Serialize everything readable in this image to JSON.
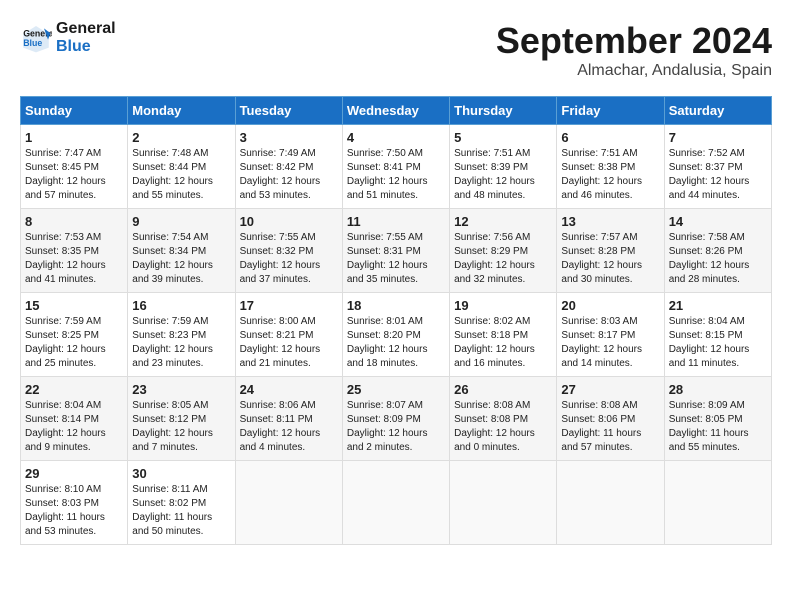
{
  "logo": {
    "line1": "General",
    "line2": "Blue"
  },
  "title": "September 2024",
  "location": "Almachar, Andalusia, Spain",
  "days_of_week": [
    "Sunday",
    "Monday",
    "Tuesday",
    "Wednesday",
    "Thursday",
    "Friday",
    "Saturday"
  ],
  "weeks": [
    [
      {
        "day": "1",
        "sunrise": "7:47 AM",
        "sunset": "8:45 PM",
        "daylight": "12 hours and 57 minutes."
      },
      {
        "day": "2",
        "sunrise": "7:48 AM",
        "sunset": "8:44 PM",
        "daylight": "12 hours and 55 minutes."
      },
      {
        "day": "3",
        "sunrise": "7:49 AM",
        "sunset": "8:42 PM",
        "daylight": "12 hours and 53 minutes."
      },
      {
        "day": "4",
        "sunrise": "7:50 AM",
        "sunset": "8:41 PM",
        "daylight": "12 hours and 51 minutes."
      },
      {
        "day": "5",
        "sunrise": "7:51 AM",
        "sunset": "8:39 PM",
        "daylight": "12 hours and 48 minutes."
      },
      {
        "day": "6",
        "sunrise": "7:51 AM",
        "sunset": "8:38 PM",
        "daylight": "12 hours and 46 minutes."
      },
      {
        "day": "7",
        "sunrise": "7:52 AM",
        "sunset": "8:37 PM",
        "daylight": "12 hours and 44 minutes."
      }
    ],
    [
      {
        "day": "8",
        "sunrise": "7:53 AM",
        "sunset": "8:35 PM",
        "daylight": "12 hours and 41 minutes."
      },
      {
        "day": "9",
        "sunrise": "7:54 AM",
        "sunset": "8:34 PM",
        "daylight": "12 hours and 39 minutes."
      },
      {
        "day": "10",
        "sunrise": "7:55 AM",
        "sunset": "8:32 PM",
        "daylight": "12 hours and 37 minutes."
      },
      {
        "day": "11",
        "sunrise": "7:55 AM",
        "sunset": "8:31 PM",
        "daylight": "12 hours and 35 minutes."
      },
      {
        "day": "12",
        "sunrise": "7:56 AM",
        "sunset": "8:29 PM",
        "daylight": "12 hours and 32 minutes."
      },
      {
        "day": "13",
        "sunrise": "7:57 AM",
        "sunset": "8:28 PM",
        "daylight": "12 hours and 30 minutes."
      },
      {
        "day": "14",
        "sunrise": "7:58 AM",
        "sunset": "8:26 PM",
        "daylight": "12 hours and 28 minutes."
      }
    ],
    [
      {
        "day": "15",
        "sunrise": "7:59 AM",
        "sunset": "8:25 PM",
        "daylight": "12 hours and 25 minutes."
      },
      {
        "day": "16",
        "sunrise": "7:59 AM",
        "sunset": "8:23 PM",
        "daylight": "12 hours and 23 minutes."
      },
      {
        "day": "17",
        "sunrise": "8:00 AM",
        "sunset": "8:21 PM",
        "daylight": "12 hours and 21 minutes."
      },
      {
        "day": "18",
        "sunrise": "8:01 AM",
        "sunset": "8:20 PM",
        "daylight": "12 hours and 18 minutes."
      },
      {
        "day": "19",
        "sunrise": "8:02 AM",
        "sunset": "8:18 PM",
        "daylight": "12 hours and 16 minutes."
      },
      {
        "day": "20",
        "sunrise": "8:03 AM",
        "sunset": "8:17 PM",
        "daylight": "12 hours and 14 minutes."
      },
      {
        "day": "21",
        "sunrise": "8:04 AM",
        "sunset": "8:15 PM",
        "daylight": "12 hours and 11 minutes."
      }
    ],
    [
      {
        "day": "22",
        "sunrise": "8:04 AM",
        "sunset": "8:14 PM",
        "daylight": "12 hours and 9 minutes."
      },
      {
        "day": "23",
        "sunrise": "8:05 AM",
        "sunset": "8:12 PM",
        "daylight": "12 hours and 7 minutes."
      },
      {
        "day": "24",
        "sunrise": "8:06 AM",
        "sunset": "8:11 PM",
        "daylight": "12 hours and 4 minutes."
      },
      {
        "day": "25",
        "sunrise": "8:07 AM",
        "sunset": "8:09 PM",
        "daylight": "12 hours and 2 minutes."
      },
      {
        "day": "26",
        "sunrise": "8:08 AM",
        "sunset": "8:08 PM",
        "daylight": "12 hours and 0 minutes."
      },
      {
        "day": "27",
        "sunrise": "8:08 AM",
        "sunset": "8:06 PM",
        "daylight": "11 hours and 57 minutes."
      },
      {
        "day": "28",
        "sunrise": "8:09 AM",
        "sunset": "8:05 PM",
        "daylight": "11 hours and 55 minutes."
      }
    ],
    [
      {
        "day": "29",
        "sunrise": "8:10 AM",
        "sunset": "8:03 PM",
        "daylight": "11 hours and 53 minutes."
      },
      {
        "day": "30",
        "sunrise": "8:11 AM",
        "sunset": "8:02 PM",
        "daylight": "11 hours and 50 minutes."
      },
      null,
      null,
      null,
      null,
      null
    ]
  ]
}
